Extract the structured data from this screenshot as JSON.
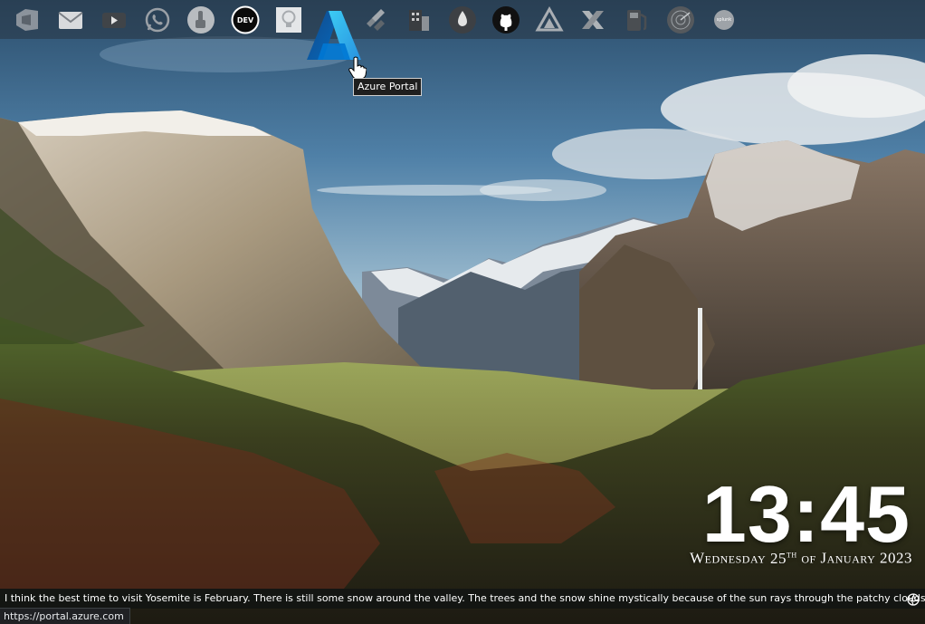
{
  "dock": {
    "items": [
      {
        "name": "app-1",
        "icon": "stack-arrow-icon"
      },
      {
        "name": "mail",
        "icon": "mail-icon"
      },
      {
        "name": "video",
        "icon": "play-icon"
      },
      {
        "name": "whatsapp",
        "icon": "whatsapp-icon"
      },
      {
        "name": "app-5",
        "icon": "hand-icon"
      },
      {
        "name": "dev",
        "icon": "dev-icon",
        "label": "DEV"
      },
      {
        "name": "ideas",
        "icon": "lightbulb-icon"
      },
      {
        "name": "azure-portal",
        "icon": "azure-icon",
        "label": "A"
      },
      {
        "name": "jira",
        "icon": "jira-icon"
      },
      {
        "name": "app-10",
        "icon": "building-icon"
      },
      {
        "name": "app-11",
        "icon": "flame-icon"
      },
      {
        "name": "github",
        "icon": "github-icon"
      },
      {
        "name": "app-13",
        "icon": "triangle-icon"
      },
      {
        "name": "app-14",
        "icon": "x-icon"
      },
      {
        "name": "fuel",
        "icon": "fuel-icon"
      },
      {
        "name": "radar",
        "icon": "radar-icon"
      },
      {
        "name": "splunk",
        "icon": "splunk-icon",
        "label": "splunk"
      }
    ],
    "tooltip": "Azure Portal"
  },
  "clock": {
    "time": "13:45",
    "weekday": "Wednesday",
    "day": "25",
    "day_suffix": "th",
    "of": "of",
    "month": "January",
    "year": "2023"
  },
  "caption": {
    "text": "I think the best time to visit Yosemite is February. There is still some snow around the valley. The trees and the snow shine mystically because of the sun rays through the patchy clouds. Certainly",
    "icon": "camera-aperture-icon"
  },
  "status": {
    "url": "https://portal.azure.com"
  },
  "colors": {
    "azure_light": "#3ccbf4",
    "azure_dark": "#0a5ec9",
    "dock_bg": "#28344288"
  }
}
